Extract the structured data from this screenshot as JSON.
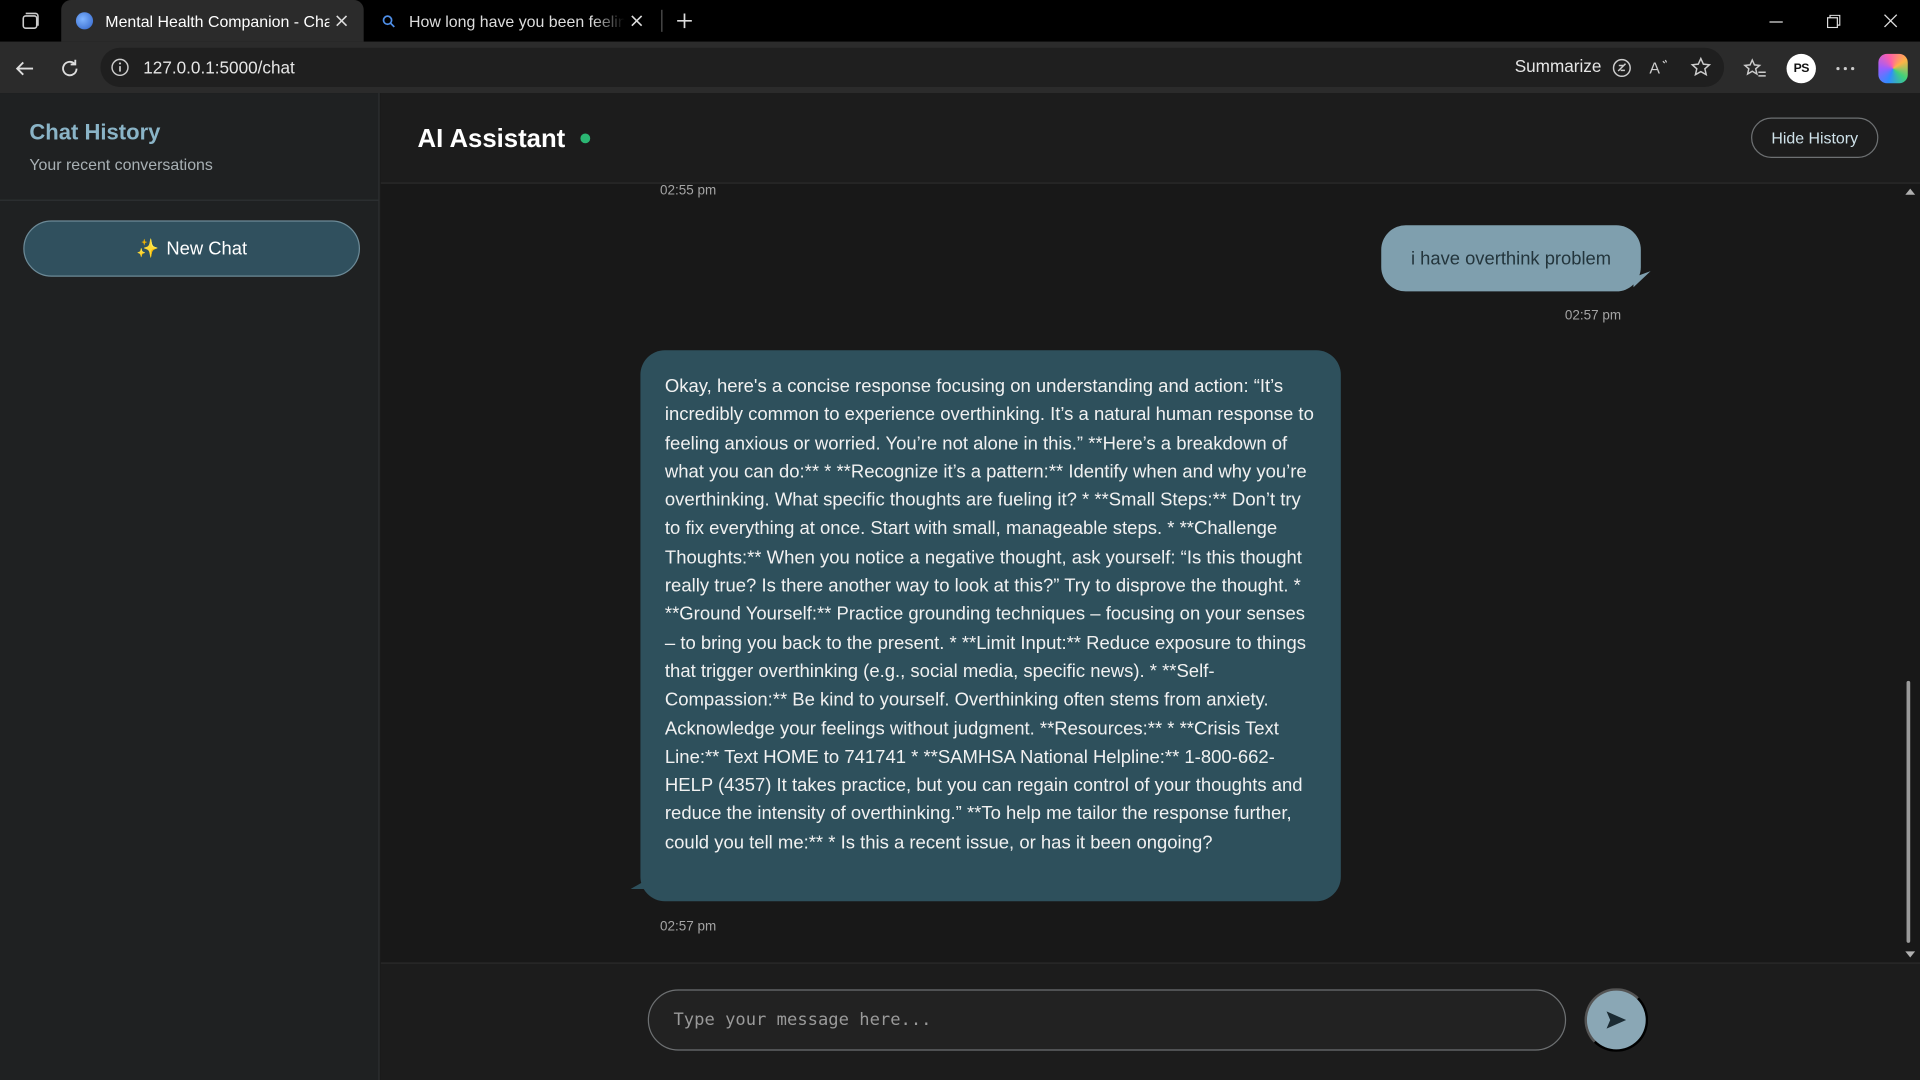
{
  "browser": {
    "tabs": [
      {
        "title": "Mental Health Companion - Chat",
        "active": true
      },
      {
        "title": "How long have you been feeling t",
        "active": false
      }
    ],
    "url": "127.0.0.1:5000/chat",
    "summarize_label": "Summarize",
    "profile_initials": "PS"
  },
  "sidebar": {
    "title": "Chat History",
    "subtitle": "Your recent conversations",
    "new_chat_icon": "✨",
    "new_chat_label": "New Chat"
  },
  "header": {
    "title": "AI Assistant",
    "status_color": "#2bb673",
    "hide_history_label": "Hide History"
  },
  "messages": [
    {
      "role": "assistant",
      "time": "02:55 pm",
      "text": ""
    },
    {
      "role": "user",
      "time": "02:57 pm",
      "text": "i have overthink problem"
    },
    {
      "role": "assistant",
      "time": "02:57 pm",
      "text": "Okay, here's a concise response focusing on understanding and action: “It’s incredibly common to experience overthinking. It’s a natural human response to feeling anxious or worried. You’re not alone in this.” **Here’s a breakdown of what you can do:** * **Recognize it’s a pattern:** Identify when and why you’re overthinking. What specific thoughts are fueling it? * **Small Steps:** Don’t try to fix everything at once. Start with small, manageable steps. * **Challenge Thoughts:** When you notice a negative thought, ask yourself: “Is this thought really true? Is there another way to look at this?” Try to disprove the thought. * **Ground Yourself:** Practice grounding techniques – focusing on your senses – to bring you back to the present. * **Limit Input:** Reduce exposure to things that trigger overthinking (e.g., social media, specific news). * **Self-Compassion:** Be kind to yourself. Overthinking often stems from anxiety. Acknowledge your feelings without judgment. **Resources:** * **Crisis Text Line:** Text HOME to 741741 * **SAMHSA National Helpline:** 1-800-662-HELP (4357) It takes practice, but you can regain control of your thoughts and reduce the intensity of overthinking.” **To help me tailor the response further, could you tell me:** * Is this a recent issue, or has it been ongoing?"
    }
  ],
  "composer": {
    "placeholder": "Type your message here...",
    "value": "",
    "send_icon": "➤"
  },
  "colors": {
    "accent": "#8ab4c7",
    "user_bubble": "#7f9fae",
    "assistant_bubble": "#2e505c",
    "send_button": "#8aa7b5"
  }
}
